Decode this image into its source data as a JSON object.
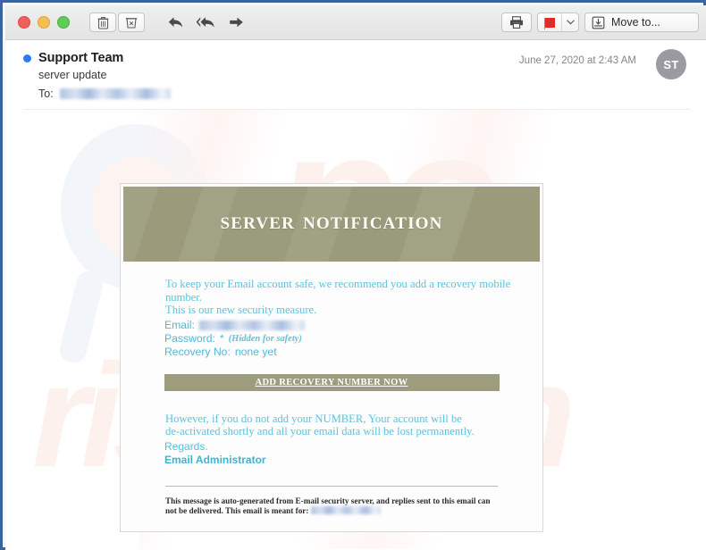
{
  "window": {
    "app": "Mail",
    "traffic_lights": [
      "close",
      "minimize",
      "maximize"
    ]
  },
  "toolbar": {
    "delete_label": "Delete",
    "junk_label": "Junk",
    "reply_label": "Reply",
    "reply_all_label": "Reply All",
    "forward_label": "Forward",
    "print_label": "Print",
    "flag_label": "Flag",
    "flag_color": "#e02b2b",
    "flag_dropdown_label": "Flag options",
    "move_to_label": "Move to..."
  },
  "message": {
    "unread": true,
    "sender": "Support Team",
    "subject": "server update",
    "to_label": "To:",
    "to_value_redacted": true,
    "date": "June 27, 2020 at 2:43 AM",
    "avatar_initials": "ST"
  },
  "phishing_email": {
    "banner_title": "SERVER  NOTIFICATION",
    "banner_color": "#9d9d7e",
    "body_line_1": "To keep your Email account safe, we recommend you add a recovery mobile number.",
    "body_line_2": "This is our new security measure.",
    "credentials": {
      "email_label": "Email:",
      "email_value_redacted": true,
      "password_label": "Password:",
      "password_value": "*",
      "password_note": "(Hidden for safety)",
      "recovery_label": "Recovery No:",
      "recovery_value": "none yet"
    },
    "cta_label": "ADD RECOVERY NUMBER NOW",
    "cta_color": "#9d9d7e",
    "warning_line_1": "However, if you do not add your NUMBER, Your account will be",
    "warning_line_2": "de-activated shortly and all your email data will be lost permanently.",
    "regards": "Regards.",
    "signature": "Email Administrator",
    "footer_line_1": "This message is auto-generated from E-mail security server, and replies sent to this email can not be delivered. This email",
    "footer_line_2": "is meant for:",
    "footer_value_redacted": true,
    "text_color": "#5cc2dd"
  },
  "watermark": {
    "text_primary": "pc",
    "text_secondary": "risk.com",
    "color": "#fdf1ee"
  }
}
